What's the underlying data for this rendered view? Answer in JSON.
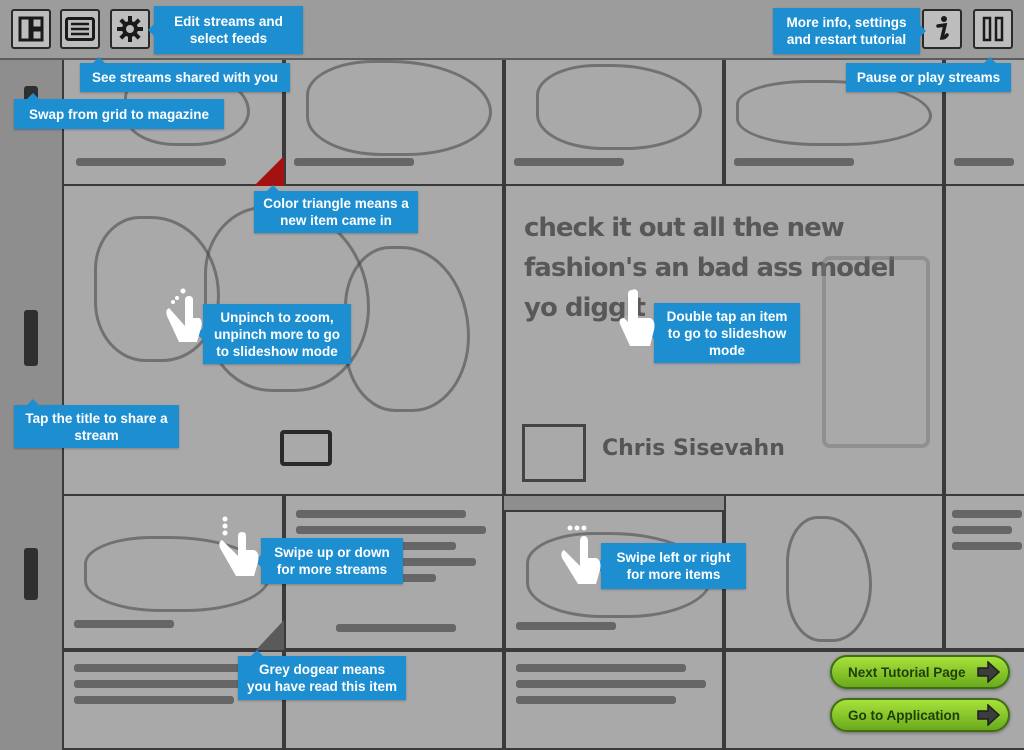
{
  "toolbar": {
    "buttons": {
      "grid_magazine": "grid-magazine-icon",
      "streams": "stream-list-icon",
      "settings": "gear-icon",
      "info": "info-icon",
      "pause": "pause-icon"
    }
  },
  "background": {
    "post_text": [
      "check it out all the new",
      "fashion's an bad ass model",
      "yo diggit"
    ],
    "post_author": "Chris Sisevahn"
  },
  "callouts": {
    "edit_streams": "Edit streams and select feeds",
    "shared_streams": "See streams shared with you",
    "swap_view": "Swap from grid to magazine",
    "color_triangle": "Color triangle means a new item came in",
    "unpinch": "Unpinch to zoom, unpinch more to go to slideshow mode",
    "double_tap": "Double tap an item to go to slideshow mode",
    "tap_title": "Tap the title to share a stream",
    "swipe_vertical": "Swipe up or down for more streams",
    "swipe_horizontal": "Swipe left or right for more items",
    "dogear": "Grey dogear means you have read this item",
    "more_info": "More info, settings and restart tutorial",
    "pause_play": "Pause or play streams"
  },
  "actions": {
    "next_page": "Next Tutorial Page",
    "go_app": "Go to Application"
  },
  "colors": {
    "callout": "#1d8fd1",
    "new_item_triangle": "#a31111",
    "green_button": "#8cc832"
  }
}
